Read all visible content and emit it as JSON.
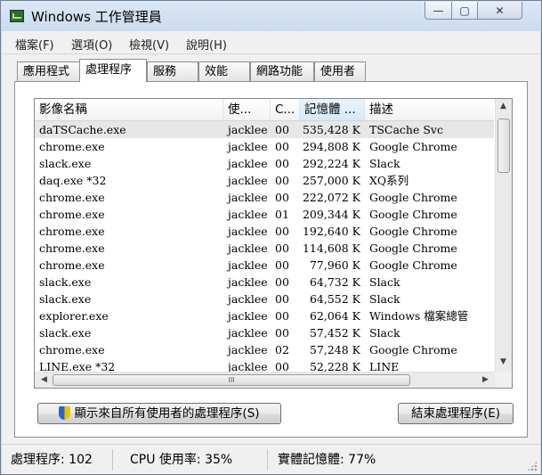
{
  "window": {
    "title": "Windows 工作管理員",
    "controls": {
      "minimize": "—",
      "maximize": "▢",
      "close": "✕"
    }
  },
  "menu": [
    "檔案(F)",
    "選項(O)",
    "檢視(V)",
    "說明(H)"
  ],
  "tabs": [
    {
      "label": "應用程式",
      "active": false
    },
    {
      "label": "處理程序",
      "active": true
    },
    {
      "label": "服務",
      "active": false
    },
    {
      "label": "效能",
      "active": false
    },
    {
      "label": "網路功能",
      "active": false
    },
    {
      "label": "使用者",
      "active": false
    }
  ],
  "columns": [
    "影像名稱",
    "使...",
    "C...",
    "記憶體 ...",
    "描述"
  ],
  "processes": [
    {
      "name": "daTSCache.exe",
      "user": "jacklee",
      "cpu": "00",
      "memory": "535,428 K",
      "description": "TSCache Svc"
    },
    {
      "name": "chrome.exe",
      "user": "jacklee",
      "cpu": "00",
      "memory": "294,808 K",
      "description": "Google Chrome"
    },
    {
      "name": "slack.exe",
      "user": "jacklee",
      "cpu": "00",
      "memory": "292,224 K",
      "description": "Slack"
    },
    {
      "name": "daq.exe *32",
      "user": "jacklee",
      "cpu": "00",
      "memory": "257,000 K",
      "description": "XQ系列"
    },
    {
      "name": "chrome.exe",
      "user": "jacklee",
      "cpu": "00",
      "memory": "222,072 K",
      "description": "Google Chrome"
    },
    {
      "name": "chrome.exe",
      "user": "jacklee",
      "cpu": "01",
      "memory": "209,344 K",
      "description": "Google Chrome"
    },
    {
      "name": "chrome.exe",
      "user": "jacklee",
      "cpu": "00",
      "memory": "192,640 K",
      "description": "Google Chrome"
    },
    {
      "name": "chrome.exe",
      "user": "jacklee",
      "cpu": "00",
      "memory": "114,608 K",
      "description": "Google Chrome"
    },
    {
      "name": "chrome.exe",
      "user": "jacklee",
      "cpu": "00",
      "memory": "77,960 K",
      "description": "Google Chrome"
    },
    {
      "name": "slack.exe",
      "user": "jacklee",
      "cpu": "00",
      "memory": "64,732 K",
      "description": "Slack"
    },
    {
      "name": "slack.exe",
      "user": "jacklee",
      "cpu": "00",
      "memory": "64,552 K",
      "description": "Slack"
    },
    {
      "name": "explorer.exe",
      "user": "jacklee",
      "cpu": "00",
      "memory": "62,064 K",
      "description": "Windows 檔案總管"
    },
    {
      "name": "slack.exe",
      "user": "jacklee",
      "cpu": "00",
      "memory": "57,452 K",
      "description": "Slack"
    },
    {
      "name": "chrome.exe",
      "user": "jacklee",
      "cpu": "02",
      "memory": "57,248 K",
      "description": "Google Chrome"
    },
    {
      "name": "LINE.exe *32",
      "user": "jacklee",
      "cpu": "00",
      "memory": "52,228 K",
      "description": "LINE"
    }
  ],
  "buttons": {
    "show_all": "顯示來自所有使用者的處理程序(S)",
    "end_process": "結束處理程序(E)"
  },
  "scroll": {
    "up": "▲",
    "down": "▼",
    "left": "◀",
    "right": "▶",
    "grip": "III"
  },
  "status": {
    "processes": "處理程序: 102",
    "cpu": "CPU 使用率: 35%",
    "memory": "實體記憶體: 77%"
  }
}
